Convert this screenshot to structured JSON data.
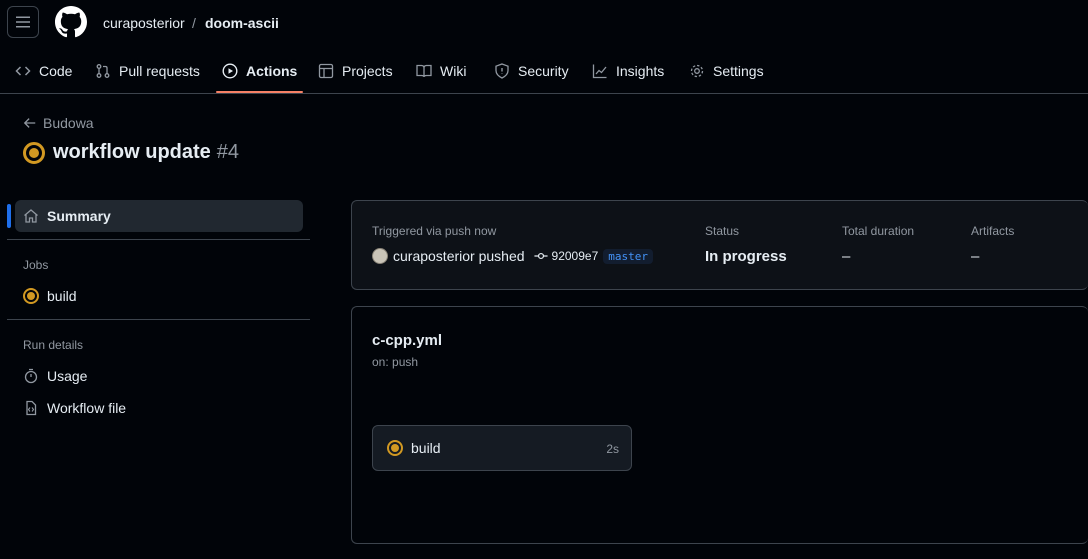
{
  "header": {
    "owner": "curaposterior",
    "separator": "/",
    "repo": "doom-ascii"
  },
  "tabs": [
    {
      "label": "Code",
      "icon": "code-icon"
    },
    {
      "label": "Pull requests",
      "icon": "git-pull-request-icon"
    },
    {
      "label": "Actions",
      "icon": "play-icon",
      "active": true
    },
    {
      "label": "Projects",
      "icon": "table-icon"
    },
    {
      "label": "Wiki",
      "icon": "book-icon"
    },
    {
      "label": "Security",
      "icon": "shield-icon"
    },
    {
      "label": "Insights",
      "icon": "graph-icon"
    },
    {
      "label": "Settings",
      "icon": "gear-icon"
    }
  ],
  "run": {
    "back_label": "Budowa",
    "title": "workflow update",
    "number": "#4"
  },
  "sidebar": {
    "summary_label": "Summary",
    "jobs_heading": "Jobs",
    "jobs": [
      {
        "label": "build"
      }
    ],
    "run_details_heading": "Run details",
    "details": [
      {
        "label": "Usage",
        "icon": "stopwatch-icon"
      },
      {
        "label": "Workflow file",
        "icon": "file-code-icon"
      }
    ]
  },
  "summary": {
    "trigger_label": "Triggered via push now",
    "actor": "curaposterior pushed",
    "commit": "92009e7",
    "branch": "master",
    "status_label": "Status",
    "status_value": "In progress",
    "duration_label": "Total duration",
    "duration_value": "–",
    "artifacts_label": "Artifacts",
    "artifacts_value": "–"
  },
  "workflow": {
    "name": "c-cpp.yml",
    "trigger": "on: push",
    "job_name": "build",
    "job_duration": "2s"
  },
  "colors": {
    "background": "#010409",
    "accent_underline": "#f78166",
    "in_progress": "#d29922",
    "active_indicator": "#1f6feb",
    "branch_text": "#4493f8"
  }
}
